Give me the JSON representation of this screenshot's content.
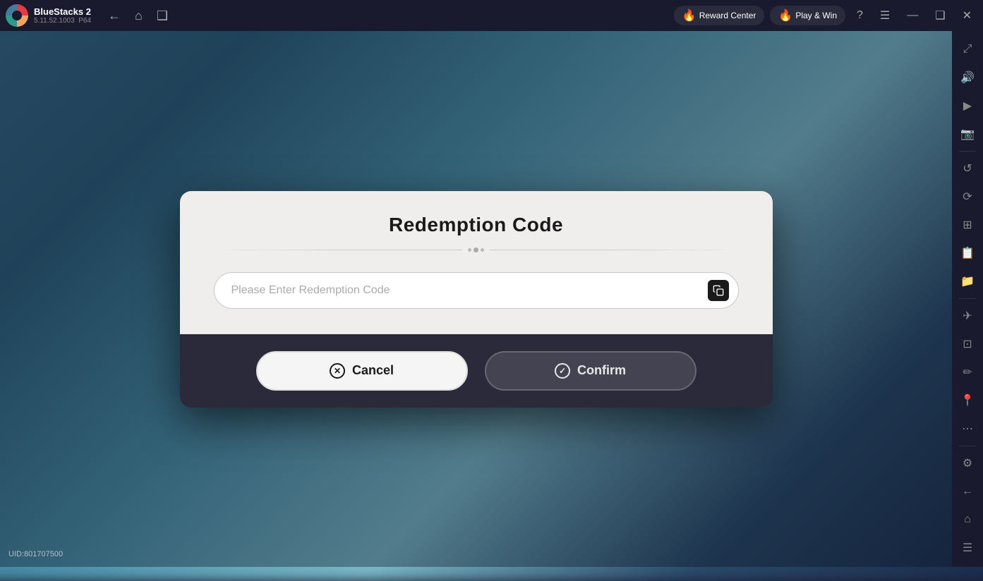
{
  "app": {
    "name": "BlueStacks 2",
    "version": "5.11.52.1003",
    "arch": "P64"
  },
  "topbar": {
    "back_label": "←",
    "home_label": "⌂",
    "duplicate_label": "❑",
    "reward_center_label": "Reward Center",
    "reward_center_icon": "🔥",
    "play_win_label": "Play & Win",
    "play_win_icon": "🔥",
    "help_icon": "?",
    "menu_icon": "☰",
    "minimize_icon": "—",
    "restore_icon": "❑",
    "close_icon": "✕",
    "expand_icon": "⤢"
  },
  "sidebar": {
    "icons": [
      {
        "name": "expand-icon",
        "symbol": "⤢"
      },
      {
        "name": "volume-icon",
        "symbol": "🔊"
      },
      {
        "name": "video-icon",
        "symbol": "▶"
      },
      {
        "name": "screenshot-icon",
        "symbol": "📷"
      },
      {
        "name": "rotate-icon",
        "symbol": "↺"
      },
      {
        "name": "refresh-icon",
        "symbol": "⟳"
      },
      {
        "name": "apps-icon",
        "symbol": "⊞"
      },
      {
        "name": "book-icon",
        "symbol": "📋"
      },
      {
        "name": "folder-icon",
        "symbol": "📁"
      },
      {
        "name": "plane-icon",
        "symbol": "✈"
      },
      {
        "name": "resize-icon",
        "symbol": "⊡"
      },
      {
        "name": "pen-icon",
        "symbol": "✏"
      },
      {
        "name": "location-icon",
        "symbol": "📍"
      },
      {
        "name": "more-icon",
        "symbol": "⋯"
      },
      {
        "name": "settings-icon",
        "symbol": "⚙"
      },
      {
        "name": "back-icon",
        "symbol": "←"
      },
      {
        "name": "house-icon",
        "symbol": "⌂"
      },
      {
        "name": "menu2-icon",
        "symbol": "☰"
      }
    ]
  },
  "dialog": {
    "title": "Redemption Code",
    "input_placeholder": "Please Enter Redemption Code",
    "cancel_label": "Cancel",
    "confirm_label": "Confirm"
  },
  "uid": {
    "label": "UID:801707500"
  }
}
